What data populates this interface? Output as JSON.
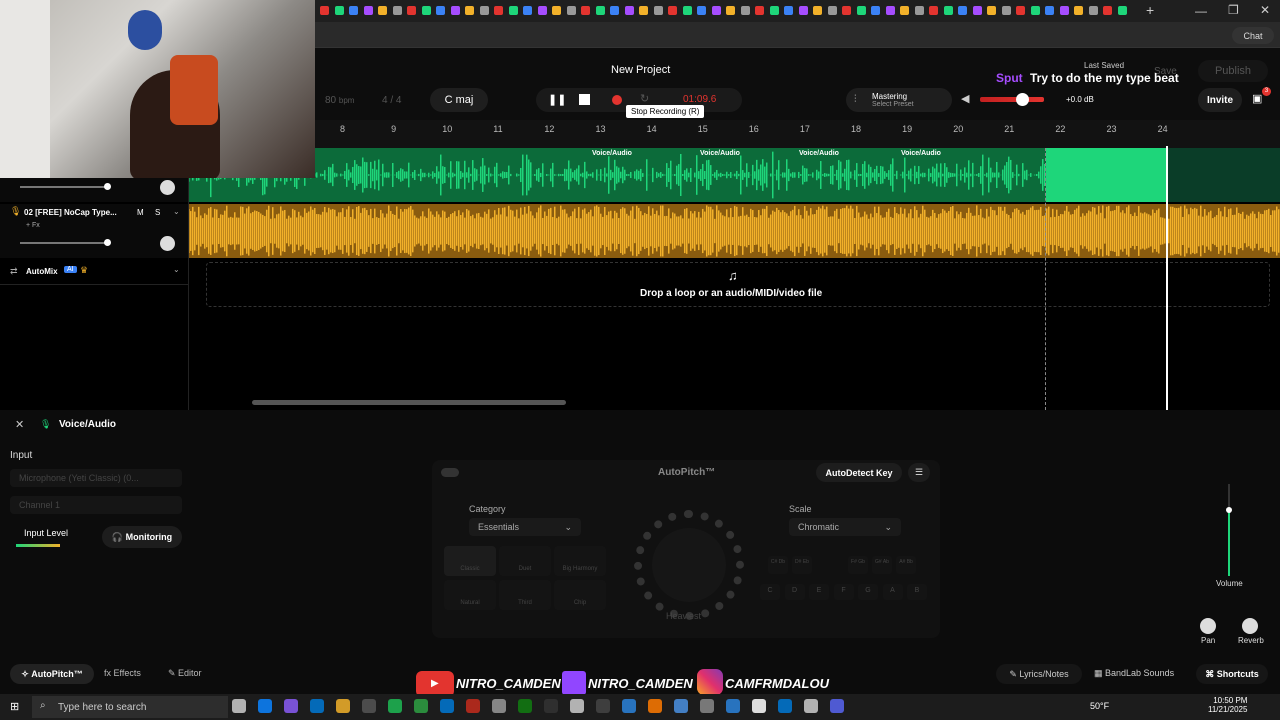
{
  "header": {
    "project_title": "New Project",
    "bpm_value": "80",
    "bpm_label": "bpm",
    "time_sig": "4 / 4",
    "key": "C maj",
    "timecode": "01:09.6",
    "tooltip": "Stop Recording (R)",
    "mastering_label": "Mastering",
    "mastering_preset": "Select Preset",
    "volume_db": "+0.0 dB",
    "last_saved": "Last Saved",
    "save_label": "Save",
    "publish_label": "Publish",
    "invite_label": "Invite",
    "chat_label": "Chat",
    "notification_count": "3"
  },
  "overlay": {
    "username": "Sput",
    "message": "Try to do the my type beat"
  },
  "ruler": [
    "8",
    "9",
    "10",
    "11",
    "12",
    "13",
    "14",
    "15",
    "16",
    "17",
    "18",
    "19",
    "20",
    "21",
    "22",
    "23",
    "24"
  ],
  "tracks": {
    "track2_name": "02  [FREE] NoCap Type...",
    "track2_m": "M",
    "track2_s": "S",
    "track2_fx": "+ Fx",
    "automix_label": "AutoMix",
    "automix_badge": "AI",
    "clip_labels": [
      "Voice/Audio",
      "Voice/Audio",
      "Voice/Audio",
      "Voice/Audio"
    ],
    "drop_text": "Drop a loop or an audio/MIDI/video file"
  },
  "panel": {
    "title": "Voice/Audio",
    "input_label": "Input",
    "mic_select": "Microphone (Yeti Classic) (0...",
    "channel_select": "Channel 1",
    "input_level": "Input Level",
    "monitoring": "Monitoring",
    "autopitch_title": "AutoPitch™",
    "autodetect": "AutoDetect Key",
    "category_label": "Category",
    "category_value": "Essentials",
    "scale_label": "Scale",
    "scale_value": "Chromatic",
    "knob_label": "Heaviest",
    "presets": [
      "Classic",
      "Duet",
      "Big Harmony",
      "Natural",
      "Third",
      "Chip"
    ],
    "key_pairs": [
      "C# Db",
      "D# Eb",
      "F# Gb",
      "G# Ab",
      "A# Bb"
    ],
    "keys": [
      "C",
      "D",
      "E",
      "F",
      "G",
      "A",
      "B"
    ],
    "volume_label": "Volume",
    "pan_label": "Pan",
    "reverb_label": "Reverb"
  },
  "bottom_tabs": {
    "autopitch": "AutoPitch™",
    "effects": "Effects",
    "editor": "Editor",
    "lyrics": "Lyrics/Notes",
    "sounds": "BandLab Sounds",
    "shortcuts": "Shortcuts"
  },
  "socials": {
    "youtube": "NITRO_CAMDEN",
    "twitch": "NITRO_CAMDEN",
    "instagram": "CAMFRMDALOU"
  },
  "taskbar": {
    "search_placeholder": "Type here to search",
    "weather": "50°F",
    "time": "10:50 PM",
    "date": "11/21/2025"
  },
  "colors": {
    "green": "#1ed67a",
    "orange": "#f2b12a",
    "red": "#e3342f",
    "purple": "#a64dff",
    "accent": "#ffffff"
  }
}
